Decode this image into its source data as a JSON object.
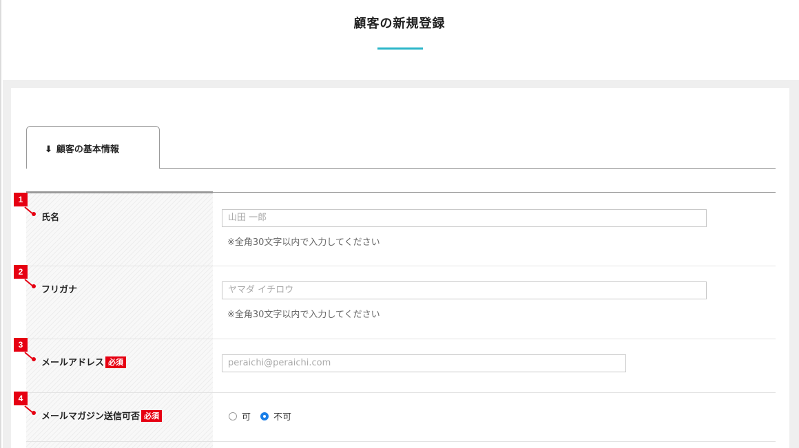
{
  "page_title": "顧客の新規登録",
  "tab": {
    "arrow": "⬇",
    "label": "顧客の基本情報"
  },
  "required_badge": "必須",
  "fields": [
    {
      "num": "1",
      "label": "氏名",
      "placeholder": "山田 一郎",
      "hint": "※全角30文字以内で入力してください"
    },
    {
      "num": "2",
      "label": "フリガナ",
      "placeholder": "ヤマダ イチロウ",
      "hint": "※全角30文字以内で入力してください"
    },
    {
      "num": "3",
      "label": "メールアドレス",
      "placeholder": "peraichi@peraichi.com"
    },
    {
      "num": "4",
      "label": "メールマガジン送信可否",
      "options": [
        {
          "label": "可",
          "selected": false
        },
        {
          "label": "不可",
          "selected": true
        }
      ]
    }
  ],
  "colors": {
    "accent": "#2ab5c8",
    "required": "#e60012",
    "radio_selected": "#1a7fe8"
  }
}
